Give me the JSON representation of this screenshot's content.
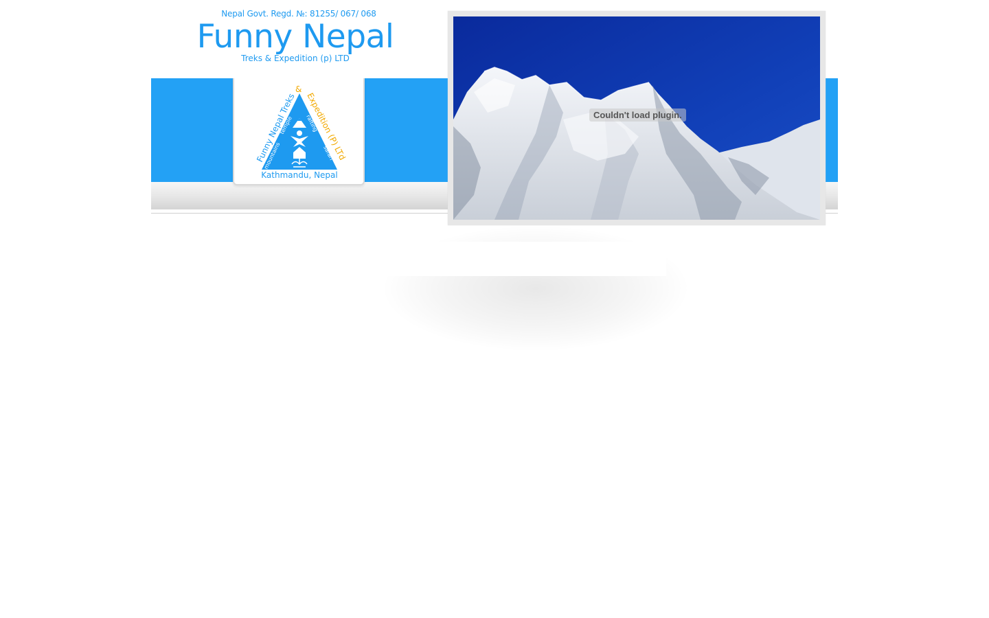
{
  "header": {
    "registration": "Nepal Govt. Regd. №:  81255/ 067/ 068",
    "brand_name": "Funny Nepal",
    "brand_tagline": "Treks & Expedition (p) LTD"
  },
  "logo": {
    "left_text": "Funny Nepal Treks",
    "ampersand": "&",
    "right_text": "Expedition (P) LTd",
    "inner_left": "mountains",
    "inner_top": "temple",
    "inner_right_top": "rafting",
    "inner_right_bottom": "safari",
    "location": "Kathmandu, Nepal"
  },
  "slideshow": {
    "plugin_message": "Couldn't load plugin."
  },
  "colors": {
    "brand_blue": "#1e9af0",
    "banner_blue": "#23a1f5",
    "logo_orange": "#f2a900",
    "sky_blue": "#0f2f9e"
  }
}
